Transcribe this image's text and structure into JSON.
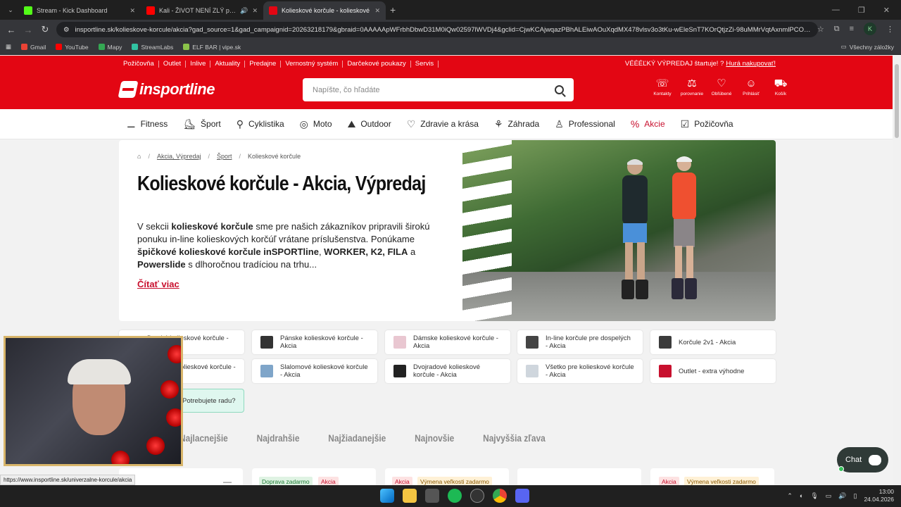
{
  "browser": {
    "tabs": [
      {
        "title": "Stream - Kick Dashboard",
        "color": "#53fc18"
      },
      {
        "title": "Kali - ŽIVOT NENÍ ZLÝ prod",
        "color": "#ff0000"
      },
      {
        "title": "Kolieskové korčule - kolieskové",
        "color": "#e30613",
        "active": true
      }
    ],
    "url": "insportline.sk/kolieskove-korcule/akcia?gad_source=1&gad_campaignid=20263218179&gbraid=0AAAAApWFrbhDbwD31M0iQw02597lWVDj4&gclid=CjwKCAjwqazPBhALEiwAOuXqdMX478vlsv3o3tKu-wEleSnT7KOrQtjzZi-98uMMrVqtAxnmlPCOKxo...",
    "profile_initial": "K",
    "bookmarks": [
      {
        "label": "Gmail",
        "color": "#ea4335"
      },
      {
        "label": "YouTube",
        "color": "#ff0000"
      },
      {
        "label": "Mapy",
        "color": "#34a853"
      },
      {
        "label": "StreamLabs",
        "color": "#31c3a2"
      },
      {
        "label": "ELF BAR | vipe.sk",
        "color": "#8bc34a"
      }
    ],
    "bookmarks_right": "Všechny záložky"
  },
  "topstrip": {
    "links": [
      "Požičovňa",
      "Outlet",
      "Inlive",
      "Aktuality",
      "Predajne",
      "Vernostný systém",
      "Darčekové poukazy",
      "Servis"
    ],
    "promo_text": "VÉÉÉĽKÝ VÝPREDAJ štartuje! ?",
    "promo_link": "Hurá nakupovať!"
  },
  "header": {
    "logo": "insportline",
    "search_placeholder": "Napíšte, čo hľadáte",
    "icons": [
      {
        "label": "Kontakty",
        "icon": "phone-icon",
        "glyph": "☏"
      },
      {
        "label": "porovnanie",
        "icon": "scale-icon",
        "glyph": "⚖"
      },
      {
        "label": "Obľúbené",
        "icon": "heart-icon",
        "glyph": "♡"
      },
      {
        "label": "Prihlásiť",
        "icon": "user-icon",
        "glyph": "☺"
      },
      {
        "label": "Košík",
        "icon": "cart-icon",
        "glyph": "🛒"
      }
    ]
  },
  "categories": [
    {
      "label": "Fitness",
      "glyph": "⚊"
    },
    {
      "label": "Šport",
      "glyph": "⛸"
    },
    {
      "label": "Cyklistika",
      "glyph": "⚲"
    },
    {
      "label": "Moto",
      "glyph": "◎"
    },
    {
      "label": "Outdoor",
      "glyph": "⛰"
    },
    {
      "label": "Zdravie a krása",
      "glyph": "♡"
    },
    {
      "label": "Záhrada",
      "glyph": "⚘"
    },
    {
      "label": "Professional",
      "glyph": "♙"
    },
    {
      "label": "Akcie",
      "glyph": "%"
    },
    {
      "label": "Požičovňa",
      "glyph": "☑"
    }
  ],
  "breadcrumb": [
    "Akcia, Výpredaj",
    "Šport",
    "Kolieskové korčule"
  ],
  "hero": {
    "title": "Kolieskové korčule - Akcia, Výpredaj",
    "intro_1": "V sekcii ",
    "intro_b1": "kolieskové korčule",
    "intro_2": " sme pre našich zákazníkov pripravili širokú ponuku in-line kolieskových korčúľ vrátane príslušenstva. Ponúkame ",
    "intro_b2": "špičkové kolieskové korčule inSPORTline",
    "intro_3": ", ",
    "intro_b3": "WORKER, K2, FILA",
    "intro_4": " a ",
    "intro_b4": "Powerslide",
    "intro_5": " s dlhoročnou tradíciou na trhu...",
    "read_more": "Čítať viac"
  },
  "subcategories": [
    "Detské kolieskové korčule - Akcia",
    "Pánske kolieskové korčule - Akcia",
    "Dámske kolieskové korčule - Akcia",
    "In-line korčule pre dospelých - Akcia",
    "Korčule 2v1 - Akcia",
    "Hokejové kolieskové korčule - Akcia",
    "Slalomové kolieskové korčule - Akcia",
    "Dvojradové kolieskové korčule - Akcia",
    "Všetko pre kolieskové korčule - Akcia",
    "Outlet - extra výhodne"
  ],
  "help": "Potrebujete radu?",
  "sort_options": [
    "Najlacnejšie",
    "Najdrahšie",
    "Najžiadanejšie",
    "Najnovšie",
    "Najvyššia zľava"
  ],
  "product_badges": [
    [],
    [
      "Doprava zadarmo",
      "Akcia"
    ],
    [
      "Akcia",
      "Výmena veľkosti zadarmo"
    ],
    [],
    [
      "Akcia",
      "Výmena veľkosti zadarmo"
    ]
  ],
  "chat_label": "Chat",
  "status_url": "https://www.insportline.sk/univerzalne-korcule/akcia",
  "clock": {
    "time": "13:00",
    "date": "24.04.2026"
  }
}
